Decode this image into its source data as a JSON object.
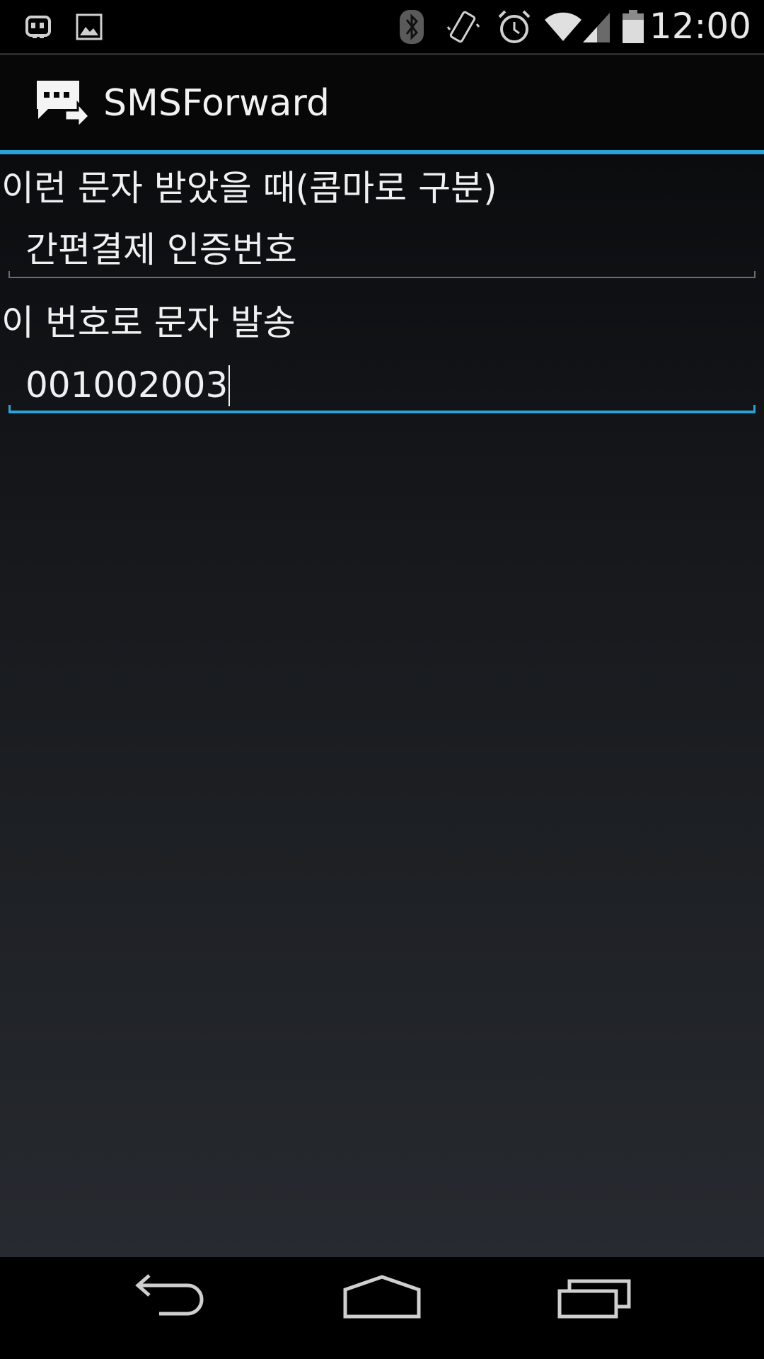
{
  "status_bar": {
    "time": "12:00",
    "left_icons": [
      "notification-app-icon",
      "gallery-icon"
    ],
    "right_icons": [
      "bluetooth-icon",
      "vibrate-icon",
      "alarm-icon",
      "wifi-icon",
      "signal-icon",
      "battery-icon"
    ]
  },
  "action_bar": {
    "title": "SMSForward",
    "icon": "sms-forward-icon",
    "accent_color": "#2aa4d8"
  },
  "form": {
    "trigger_label": "이런 문자 받았을 때(콤마로 구분)",
    "trigger_value": "간편결제 인증번호",
    "target_label": "이 번호로 문자 발송",
    "target_value": "001002003"
  },
  "nav_bar": {
    "buttons": [
      "back-icon",
      "home-icon",
      "recents-icon"
    ]
  }
}
